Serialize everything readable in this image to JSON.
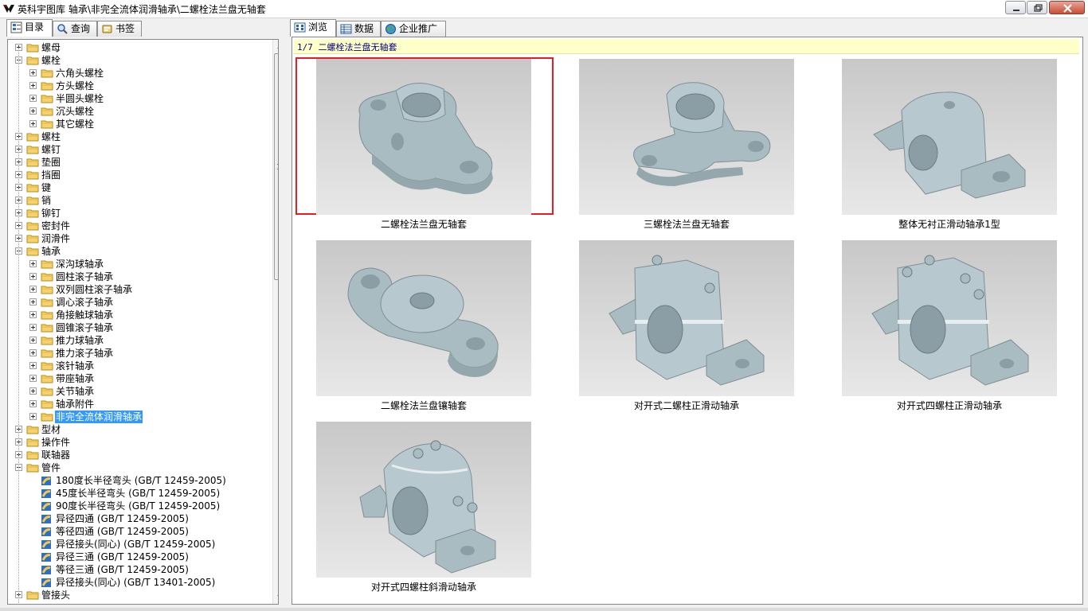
{
  "window": {
    "title": "英科宇图库  轴承\\非完全流体润滑轴承\\二螺栓法兰盘无轴套"
  },
  "left_tabs": [
    {
      "label": "目录",
      "icon": "catalog-icon"
    },
    {
      "label": "查询",
      "icon": "search-icon"
    },
    {
      "label": "书签",
      "icon": "bookmark-icon"
    }
  ],
  "tree": [
    {
      "label": "螺母",
      "level": 0,
      "expanded": false
    },
    {
      "label": "螺栓",
      "level": 0,
      "expanded": true
    },
    {
      "label": "六角头螺栓",
      "level": 1,
      "expanded": false
    },
    {
      "label": "方头螺栓",
      "level": 1,
      "expanded": false
    },
    {
      "label": "半圆头螺栓",
      "level": 1,
      "expanded": false
    },
    {
      "label": "沉头螺栓",
      "level": 1,
      "expanded": false
    },
    {
      "label": "其它螺栓",
      "level": 1,
      "expanded": false
    },
    {
      "label": "螺柱",
      "level": 0,
      "expanded": false
    },
    {
      "label": "螺钉",
      "level": 0,
      "expanded": false
    },
    {
      "label": "垫圈",
      "level": 0,
      "expanded": false
    },
    {
      "label": "挡圈",
      "level": 0,
      "expanded": false
    },
    {
      "label": "键",
      "level": 0,
      "expanded": false
    },
    {
      "label": "销",
      "level": 0,
      "expanded": false
    },
    {
      "label": "铆钉",
      "level": 0,
      "expanded": false
    },
    {
      "label": "密封件",
      "level": 0,
      "expanded": false
    },
    {
      "label": "润滑件",
      "level": 0,
      "expanded": false
    },
    {
      "label": "轴承",
      "level": 0,
      "expanded": true
    },
    {
      "label": "深沟球轴承",
      "level": 1,
      "expanded": false
    },
    {
      "label": "圆柱滚子轴承",
      "level": 1,
      "expanded": false
    },
    {
      "label": "双列圆柱滚子轴承",
      "level": 1,
      "expanded": false
    },
    {
      "label": "调心滚子轴承",
      "level": 1,
      "expanded": false
    },
    {
      "label": "角接触球轴承",
      "level": 1,
      "expanded": false
    },
    {
      "label": "圆锥滚子轴承",
      "level": 1,
      "expanded": false
    },
    {
      "label": "推力球轴承",
      "level": 1,
      "expanded": false
    },
    {
      "label": "推力滚子轴承",
      "level": 1,
      "expanded": false
    },
    {
      "label": "滚针轴承",
      "level": 1,
      "expanded": false
    },
    {
      "label": "带座轴承",
      "level": 1,
      "expanded": false
    },
    {
      "label": "关节轴承",
      "level": 1,
      "expanded": false
    },
    {
      "label": "轴承附件",
      "level": 1,
      "expanded": false
    },
    {
      "label": "非完全流体润滑轴承",
      "level": 1,
      "expanded": false,
      "selected": true
    },
    {
      "label": "型材",
      "level": 0,
      "expanded": false
    },
    {
      "label": "操作件",
      "level": 0,
      "expanded": false
    },
    {
      "label": "联轴器",
      "level": 0,
      "expanded": false
    },
    {
      "label": "管件",
      "level": 0,
      "expanded": true
    },
    {
      "label": "180度长半径弯头 (GB/T 12459-2005)",
      "level": 1,
      "leaf": true
    },
    {
      "label": "45度长半径弯头 (GB/T 12459-2005)",
      "level": 1,
      "leaf": true
    },
    {
      "label": "90度长半径弯头 (GB/T 12459-2005)",
      "level": 1,
      "leaf": true
    },
    {
      "label": "异径四通 (GB/T 12459-2005)",
      "level": 1,
      "leaf": true
    },
    {
      "label": "等径四通 (GB/T 12459-2005)",
      "level": 1,
      "leaf": true
    },
    {
      "label": "异径接头(同心) (GB/T 12459-2005)",
      "level": 1,
      "leaf": true
    },
    {
      "label": "异径三通 (GB/T 12459-2005)",
      "level": 1,
      "leaf": true
    },
    {
      "label": "等径三通 (GB/T 12459-2005)",
      "level": 1,
      "leaf": true
    },
    {
      "label": "异径接头(同心) (GB/T 13401-2005)",
      "level": 1,
      "leaf": true
    },
    {
      "label": "管接头",
      "level": 0,
      "expanded": false
    }
  ],
  "right_tabs": [
    {
      "label": "浏览",
      "icon": "browse-icon"
    },
    {
      "label": "数据",
      "icon": "table-icon"
    },
    {
      "label": "企业推广",
      "icon": "globe-icon"
    }
  ],
  "path_bar": {
    "text": "1/7 二螺栓法兰盘无轴套"
  },
  "thumbnails": [
    {
      "caption": "二螺栓法兰盘无轴套",
      "shape": "two-bolt-flange",
      "selected": true
    },
    {
      "caption": "三螺栓法兰盘无轴套",
      "shape": "three-bolt-flange"
    },
    {
      "caption": "整体无衬正滑动轴承1型",
      "shape": "solid-pillow-block"
    },
    {
      "caption": "二螺栓法兰盘镶轴套",
      "shape": "two-bolt-flange-bushing"
    },
    {
      "caption": "对开式二螺柱正滑动轴承",
      "shape": "split-two-stud"
    },
    {
      "caption": "对开式四螺柱正滑动轴承",
      "shape": "split-four-stud"
    },
    {
      "caption": "对开式四螺柱斜滑动轴承",
      "shape": "split-four-stud-oblique"
    }
  ],
  "colors": {
    "selection": "#3399ff",
    "highlight_border": "#e31e24",
    "path_bg": "#ffffc8",
    "part": "#a9bcc2"
  }
}
